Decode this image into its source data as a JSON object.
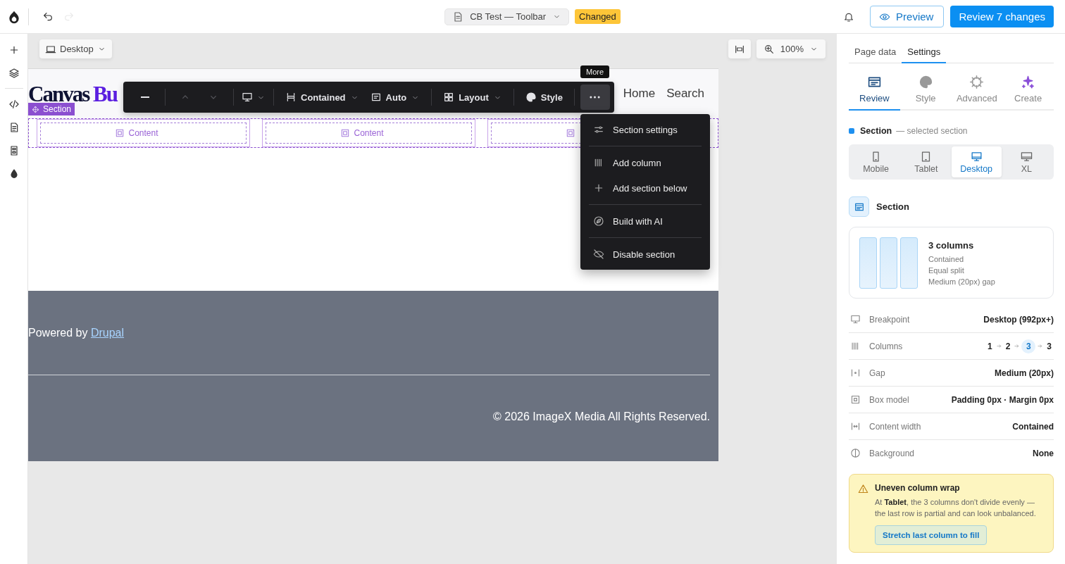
{
  "topbar": {
    "history": [
      {
        "kind": "undo",
        "disabled": false
      },
      {
        "kind": "redo",
        "disabled": true
      }
    ],
    "document": {
      "title": "CB Test — Toolbar",
      "status": "Changed"
    },
    "preview": "Preview",
    "review": "Review 7 changes"
  },
  "rail": {
    "groups": [
      [
        {
          "kind": "add"
        },
        {
          "kind": "layers"
        }
      ],
      [
        {
          "kind": "code"
        },
        {
          "kind": "page"
        },
        {
          "kind": "form"
        },
        {
          "kind": "theme"
        }
      ]
    ]
  },
  "canvas": {
    "viewport": "Desktop",
    "zoom": "100%",
    "page": {
      "logo": {
        "text": "Canvas",
        "accent": "Bu"
      },
      "nav": [
        "Home",
        "Search"
      ],
      "section_label": "Section",
      "columns": [
        {
          "kind": "content",
          "label": "Content"
        },
        {
          "kind": "content",
          "label": "Content"
        },
        {
          "kind": "content"
        }
      ],
      "footer": {
        "text": "Powered by",
        "link": "Drupal",
        "copyright": "© 2026 ImageX Media All Rights Reserved."
      }
    },
    "toolbar": [
      {
        "kind": "remove",
        "disabled": false,
        "pressed": false
      },
      {
        "kind": "separator"
      },
      {
        "kind": "move-up",
        "disabled": true,
        "pressed": false
      },
      {
        "kind": "move-down",
        "disabled": true,
        "pressed": false
      },
      {
        "kind": "separator"
      },
      {
        "kind": "breakpoint",
        "disabled": false,
        "pressed": false
      },
      {
        "kind": "separator"
      },
      {
        "kind": "width",
        "label": "Contained",
        "disabled": false,
        "pressed": false
      },
      {
        "kind": "height",
        "label": "Auto",
        "disabled": false,
        "pressed": false
      },
      {
        "kind": "separator"
      },
      {
        "kind": "layout",
        "label": "Layout",
        "disabled": false,
        "pressed": false
      },
      {
        "kind": "separator"
      },
      {
        "kind": "style",
        "label": "Style",
        "disabled": false,
        "pressed": false
      },
      {
        "kind": "separator"
      },
      {
        "kind": "more",
        "disabled": false,
        "pressed": true
      }
    ],
    "tooltip": "More",
    "menu": [
      [
        {
          "kind": "settings",
          "label": "Section settings"
        }
      ],
      [
        {
          "kind": "column",
          "label": "Add column"
        },
        {
          "kind": "add",
          "label": "Add section below"
        }
      ],
      [
        {
          "kind": "ai",
          "label": "Build with AI"
        }
      ],
      [
        {
          "kind": "disable",
          "label": "Disable section"
        }
      ]
    ]
  },
  "panel": {
    "tabs": [
      {
        "label": "Page data",
        "selected": false
      },
      {
        "label": "Settings",
        "selected": true
      }
    ],
    "subtabs": [
      {
        "kind": "review",
        "label": "Review",
        "selected": true
      },
      {
        "kind": "style",
        "label": "Style",
        "selected": false
      },
      {
        "kind": "advanced",
        "label": "Advanced",
        "selected": false
      },
      {
        "kind": "create",
        "label": "Create",
        "selected": false
      }
    ],
    "selection": {
      "name": "Section",
      "note": "— selected section"
    },
    "breakpoints": [
      {
        "kind": "mobile",
        "label": "Mobile",
        "selected": false
      },
      {
        "kind": "tablet",
        "label": "Tablet",
        "selected": false
      },
      {
        "kind": "desktop",
        "label": "Desktop",
        "selected": true
      },
      {
        "kind": "xl",
        "label": "XL",
        "selected": false
      }
    ],
    "component": "Section",
    "summary": {
      "preview": [
        {
          "kind": "column"
        },
        {
          "kind": "column"
        },
        {
          "kind": "column"
        }
      ],
      "title": "3 columns",
      "lines": [
        "Contained",
        "Equal split",
        "Medium (20px) gap"
      ]
    },
    "properties": [
      {
        "kind": "breakpoint",
        "label": "Breakpoint",
        "value": "Desktop (992px+)"
      },
      {
        "kind": "columns",
        "label": "Columns",
        "steps": [
          {
            "value": "1",
            "selected": false
          },
          {
            "value": "2",
            "selected": false
          },
          {
            "value": "3",
            "selected": true
          },
          {
            "value": "3",
            "selected": false
          }
        ]
      },
      {
        "kind": "gap",
        "label": "Gap",
        "value": "Medium (20px)"
      },
      {
        "kind": "box",
        "label": "Box model",
        "value": "Padding 0px · Margin 0px"
      },
      {
        "kind": "width",
        "label": "Content width",
        "value": "Contained"
      },
      {
        "kind": "background",
        "label": "Background",
        "value": "None"
      }
    ],
    "warning": {
      "title": "Uneven column wrap",
      "text": "At **Tablet**, the 3 columns don't divide evenly — the last row is partial and can look unbalanced.",
      "action": "Stretch last column to fill"
    }
  }
}
